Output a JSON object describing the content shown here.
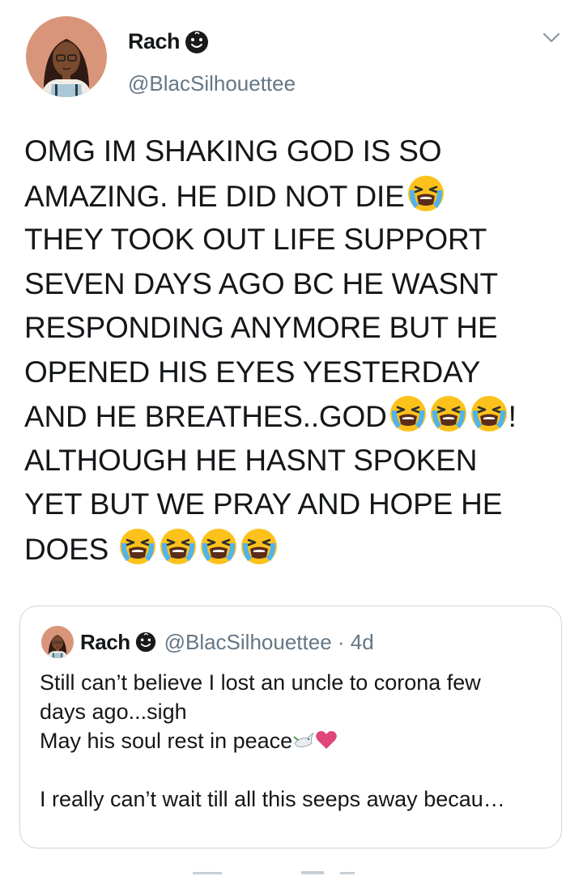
{
  "author": {
    "name": "Rach",
    "handle": "@BlacSilhouettee",
    "name_emoji": "happy-face-icon"
  },
  "tweet": {
    "lines": [
      "OMG IM SHAKING GOD IS SO",
      "AMAZING. HE DID NOT DIE",
      "THEY TOOK OUT LIFE SUPPORT",
      "SEVEN DAYS AGO BC HE WASNT",
      "RESPONDING ANYMORE BUT HE",
      "OPENED HIS EYES YESTERDAY",
      "AND HE BREATHES..GOD",
      "ALTHOUGH HE HASNT SPOKEN",
      "YET BUT WE PRAY AND HOPE HE",
      "DOES"
    ],
    "line7_suffix": "!",
    "emoji_name": "loudly-crying-face-icon"
  },
  "quoted": {
    "name": "Rach",
    "handle_meta": "@BlacSilhouettee · 4d",
    "lines": [
      "Still can’t believe I lost an uncle to corona few",
      "days ago...sigh",
      "May his soul rest in peace",
      "",
      "I really can’t wait till all this seeps away becau…"
    ]
  },
  "colors": {
    "text": "#14171a",
    "secondary": "#657786",
    "border": "#ccd6dd",
    "emoji_yellow": "#fcc21b",
    "heart": "#e0457b"
  }
}
